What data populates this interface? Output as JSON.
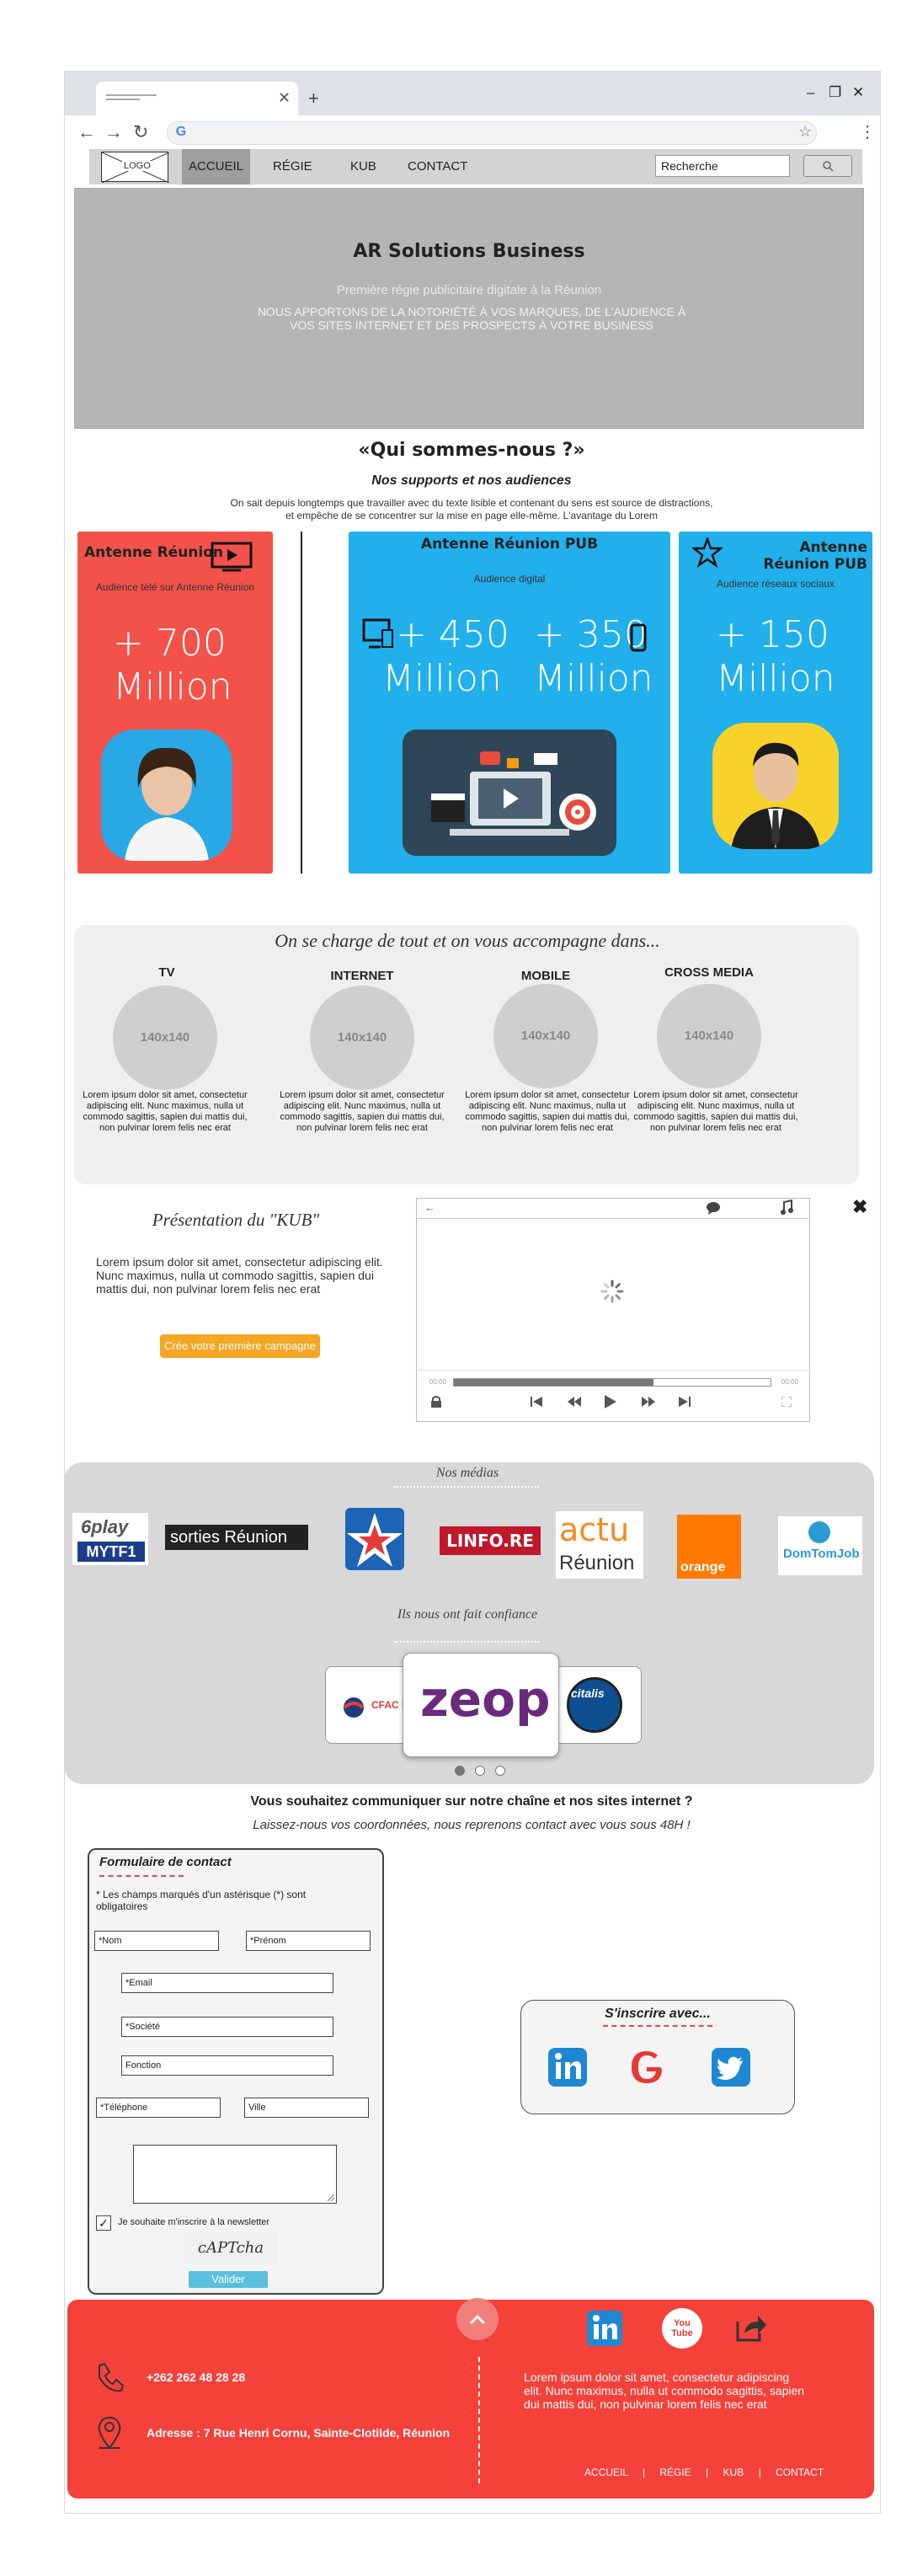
{
  "browser": {
    "new_tab": "+",
    "minimize": "–",
    "restore": "❐",
    "close": "✕",
    "back": "←",
    "forward": "→",
    "reload": "↻",
    "google_g": "G",
    "star": "☆",
    "menu": "⋮"
  },
  "nav": {
    "logo": "LOGO",
    "items": [
      "ACCUEIL",
      "RÉGIE",
      "KUB",
      "CONTACT"
    ],
    "search_value": "Recherche"
  },
  "hero": {
    "title": "AR Solutions Business",
    "subtitle": "Première régie publicitaire digitale à la Réunion",
    "text": "NOUS APPORTONS DE LA NOTORIÉTÉ À VOS MARQUES, DE L'AUDIENCE À VOS SITES INTERNET ET DES PROSPECTS À VOTRE BUSINESS"
  },
  "about": {
    "title": "«Qui sommes-nous ?»",
    "subtitle": "Nos supports et nos audiences",
    "text": "On sait depuis longtemps que travailler avec du texte lisible et contenant du sens est source de distractions, et empêche de se concentrer sur la mise en page elle-même. L'avantage du Lorem"
  },
  "cards": {
    "red": {
      "title": "Antenne Réunion",
      "sub": "Audience télé sur Antenne Réunion",
      "num": "+ 700",
      "unit": "Million"
    },
    "blue1": {
      "title": "Antenne Réunion PUB",
      "sub": "Audience digital",
      "num1": "+ 450",
      "unit1": "Million",
      "num2": "+ 350",
      "unit2": "Million"
    },
    "blue2": {
      "title": "Antenne Réunion PUB",
      "sub": "Audience réseaux sociaux",
      "num": "+ 150",
      "unit": "Million"
    }
  },
  "services": {
    "title": "On se charge de tout et on vous accompagne dans...",
    "items": [
      {
        "title": "TV",
        "img": "140x140",
        "text": "Lorem ipsum dolor sit amet, consectetur adipiscing elit. Nunc maximus, nulla ut commodo sagittis, sapien dui mattis dui, non pulvinar lorem felis nec erat"
      },
      {
        "title": "INTERNET",
        "img": "140x140",
        "text": "Lorem ipsum dolor sit amet, consectetur adipiscing elit. Nunc maximus, nulla ut commodo sagittis, sapien dui mattis dui, non pulvinar lorem felis nec erat"
      },
      {
        "title": "MOBILE",
        "img": "140x140",
        "text": "Lorem ipsum dolor sit amet, consectetur adipiscing elit. Nunc maximus, nulla ut commodo sagittis, sapien dui mattis dui, non pulvinar lorem felis nec erat"
      },
      {
        "title": "CROSS MEDIA",
        "img": "140x140",
        "text": "Lorem ipsum dolor sit amet, consectetur adipiscing elit. Nunc maximus, nulla ut commodo sagittis, sapien dui mattis dui, non pulvinar lorem felis nec erat"
      }
    ]
  },
  "kub": {
    "title": "Présentation du \"KUB\"",
    "text": "Lorem ipsum dolor sit amet, consectetur adipiscing elit. Nunc maximus, nulla ut commodo sagittis, sapien dui mattis dui, non pulvinar lorem felis nec erat",
    "button": "Crée votre première campagne",
    "player": {
      "back": "←",
      "time_start": "00:00",
      "time_end": "00:00",
      "progress": 0.63
    }
  },
  "medias": {
    "title": "Nos médias",
    "logos": [
      {
        "name": "6play",
        "sub": "MYTF1"
      },
      {
        "name": "sorties Réunion"
      },
      {
        "name": "Antenne Réunion"
      },
      {
        "name": "LINFO.RE"
      },
      {
        "name": "actu",
        "sub": "Réunion"
      },
      {
        "name": "orange"
      },
      {
        "name": "DomTomJob"
      }
    ],
    "trust_title": "Ils nous ont fait confiance",
    "trust_logos": [
      {
        "name": "CFAC RÉUNION"
      },
      {
        "name": "zeop"
      },
      {
        "name": "citalis"
      }
    ],
    "pager_active": 1
  },
  "contact": {
    "title": "Vous souhaitez communiquer sur notre chaîne et nos sites internet ?",
    "subtitle": "Laissez-nous vos coordonnées, nous reprenons contact avec vous sous 48H !",
    "form_title": "Formulaire de contact",
    "form_note": "* Les champs marqués d'un astérisque (*) sont obligatoires",
    "fields": {
      "nom": "*Nom",
      "prenom": "*Prénom",
      "email": "*Email",
      "societe": "*Société",
      "fonction": "Fonction",
      "telephone": "*Téléphone",
      "ville": "Ville"
    },
    "newsletter": "Je souhaite m'inscrire à la newsletter",
    "captcha": "cAPTcha",
    "submit": "Valider",
    "signup_title": "S'inscrire avec..."
  },
  "footer": {
    "phone": "+262 262 48 28 28",
    "address": "Adresse : 7 Rue Henri Cornu, Sainte-Clotilde, Réunion",
    "text": "Lorem ipsum dolor sit amet, consectetur adipiscing elit. Nunc maximus, nulla ut commodo sagittis, sapien dui mattis dui, non pulvinar lorem felis nec erat",
    "youtube_label": "You Tube",
    "nav": [
      "ACCUEIL",
      "RÉGIE",
      "KUB",
      "CONTACT"
    ]
  }
}
